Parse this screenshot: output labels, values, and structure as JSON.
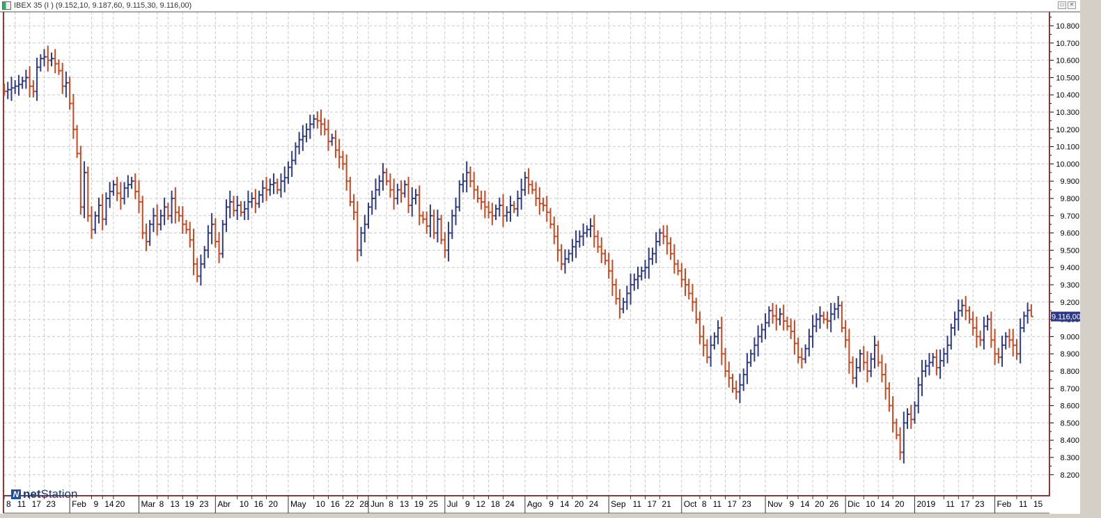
{
  "window": {
    "title": "IBEX 35 (I ) (9.152,10, 9.187,60, 9.115,30, 9.116,00)",
    "restore_icon": "restore-icon",
    "close_icon": "close-icon"
  },
  "logo": {
    "prefix": "net",
    "suffix": "Station"
  },
  "colors": {
    "up": "#2e3a86",
    "down": "#c8471e",
    "grid": "#c8c8c8",
    "frame": "#8b3a3a",
    "last_bg": "#2e3a86"
  },
  "chart_data": {
    "type": "ohlc",
    "title": "IBEX 35 (I )",
    "ylim": [
      8100,
      10900
    ],
    "yticks": [
      8200,
      8300,
      8400,
      8500,
      8600,
      8700,
      8800,
      8900,
      9000,
      9100,
      9200,
      9300,
      9400,
      9500,
      9600,
      9700,
      9800,
      9900,
      10000,
      10100,
      10200,
      10300,
      10400,
      10500,
      10600,
      10700,
      10800
    ],
    "ytick_labels": [
      "8.200",
      "8.300",
      "8.400",
      "8.500",
      "8.600",
      "8.700",
      "8.800",
      "8.900",
      "9.000",
      "9.100",
      "9.200",
      "9.300",
      "9.400",
      "9.500",
      "9.600",
      "9.700",
      "9.800",
      "9.900",
      "10.000",
      "10.100",
      "10.200",
      "10.300",
      "10.400",
      "10.500",
      "10.600",
      "10.700",
      "10.800"
    ],
    "last_value_label": "9.116,00",
    "last": {
      "open": 9152.1,
      "high": 9187.6,
      "low": 9115.3,
      "close": 9116.0
    },
    "closes": [
      10420,
      10430,
      10440,
      10450,
      10460,
      10480,
      10500,
      10450,
      10420,
      10560,
      10610,
      10620,
      10600,
      10610,
      10580,
      10540,
      10450,
      10470,
      10350,
      10200,
      10060,
      9750,
      9950,
      9700,
      9620,
      9700,
      9760,
      9680,
      9800,
      9840,
      9880,
      9830,
      9800,
      9860,
      9880,
      9900,
      9840,
      9780,
      9600,
      9550,
      9650,
      9700,
      9650,
      9700,
      9750,
      9700,
      9800,
      9720,
      9700,
      9650,
      9620,
      9560,
      9420,
      9350,
      9420,
      9500,
      9600,
      9650,
      9550,
      9480,
      9650,
      9750,
      9780,
      9730,
      9760,
      9720,
      9740,
      9780,
      9800,
      9770,
      9820,
      9860,
      9850,
      9880,
      9890,
      9850,
      9900,
      9920,
      9980,
      10020,
      10100,
      10140,
      10160,
      10200,
      10230,
      10260,
      10250,
      10230,
      10200,
      10130,
      10150,
      10080,
      10040,
      10000,
      9900,
      9780,
      9720,
      9500,
      9600,
      9650,
      9750,
      9800,
      9850,
      9900,
      9950,
      9900,
      9850,
      9800,
      9850,
      9830,
      9880,
      9760,
      9800,
      9820,
      9700,
      9680,
      9640,
      9700,
      9600,
      9680,
      9560,
      9500,
      9600,
      9700,
      9750,
      9880,
      9900,
      9950,
      9900,
      9850,
      9800,
      9780,
      9750,
      9720,
      9700,
      9740,
      9760,
      9700,
      9720,
      9760,
      9740,
      9800,
      9850,
      9920,
      9880,
      9850,
      9800,
      9770,
      9760,
      9720,
      9650,
      9580,
      9500,
      9420,
      9450,
      9480,
      9520,
      9550,
      9580,
      9600,
      9620,
      9640,
      9580,
      9520,
      9480,
      9440,
      9380,
      9300,
      9220,
      9160,
      9200,
      9250,
      9300,
      9330,
      9350,
      9380,
      9400,
      9450,
      9480,
      9550,
      9600,
      9580,
      9540,
      9480,
      9420,
      9380,
      9330,
      9300,
      9250,
      9200,
      9100,
      9000,
      8950,
      8880,
      8950,
      9000,
      9050,
      8900,
      8800,
      8760,
      8700,
      8680,
      8720,
      8780,
      8850,
      8900,
      8950,
      9000,
      9040,
      9080,
      9150,
      9120,
      9100,
      9130,
      9090,
      9060,
      9030,
      8960,
      8880,
      8870,
      8930,
      9000,
      9060,
      9100,
      9120,
      9100,
      9090,
      9130,
      9160,
      9180,
      9050,
      8980,
      8850,
      8760,
      8820,
      8900,
      8850,
      8800,
      8870,
      8950,
      8850,
      8780,
      8700,
      8600,
      8500,
      8430,
      8330,
      8500,
      8550,
      8520,
      8600,
      8720,
      8800,
      8830,
      8850,
      8880,
      8820,
      8860,
      8900,
      8950,
      9050,
      9100,
      9150,
      9180,
      9150,
      9100,
      9050,
      9000,
      8980,
      9060,
      9100,
      8980,
      8900,
      8880,
      8950,
      9000,
      8980,
      8950,
      8900,
      9050,
      9120,
      9152,
      9116
    ],
    "xticks": [
      {
        "i": 0,
        "t": "8"
      },
      {
        "i": 3,
        "t": "11"
      },
      {
        "i": 7,
        "t": "17"
      },
      {
        "i": 11,
        "t": "23"
      },
      {
        "i": 18,
        "t": "Feb",
        "m": 1
      },
      {
        "i": 24,
        "t": "9"
      },
      {
        "i": 27,
        "t": "14"
      },
      {
        "i": 30,
        "t": "20"
      },
      {
        "i": 37,
        "t": "Mar",
        "m": 1
      },
      {
        "i": 42,
        "t": "8"
      },
      {
        "i": 45,
        "t": "13"
      },
      {
        "i": 49,
        "t": "19"
      },
      {
        "i": 53,
        "t": "23"
      },
      {
        "i": 58,
        "t": "Abr",
        "m": 1
      },
      {
        "i": 64,
        "t": "10"
      },
      {
        "i": 68,
        "t": "16"
      },
      {
        "i": 72,
        "t": "20"
      },
      {
        "i": 78,
        "t": "May",
        "m": 1
      },
      {
        "i": 85,
        "t": "10"
      },
      {
        "i": 89,
        "t": "16"
      },
      {
        "i": 93,
        "t": "22"
      },
      {
        "i": 97,
        "t": "28"
      },
      {
        "i": 100,
        "t": "Jun",
        "m": 1
      },
      {
        "i": 105,
        "t": "8"
      },
      {
        "i": 108,
        "t": "13"
      },
      {
        "i": 112,
        "t": "19"
      },
      {
        "i": 116,
        "t": "25"
      },
      {
        "i": 121,
        "t": "Jul",
        "m": 1
      },
      {
        "i": 126,
        "t": "9"
      },
      {
        "i": 129,
        "t": "12"
      },
      {
        "i": 133,
        "t": "18"
      },
      {
        "i": 137,
        "t": "24"
      },
      {
        "i": 143,
        "t": "Ago",
        "m": 1
      },
      {
        "i": 149,
        "t": "9"
      },
      {
        "i": 152,
        "t": "14"
      },
      {
        "i": 156,
        "t": "20"
      },
      {
        "i": 160,
        "t": "24"
      },
      {
        "i": 166,
        "t": "Sep",
        "m": 1
      },
      {
        "i": 172,
        "t": "11"
      },
      {
        "i": 176,
        "t": "17"
      },
      {
        "i": 180,
        "t": "21"
      },
      {
        "i": 186,
        "t": "Oct",
        "m": 1
      },
      {
        "i": 191,
        "t": "8"
      },
      {
        "i": 194,
        "t": "11"
      },
      {
        "i": 198,
        "t": "17"
      },
      {
        "i": 202,
        "t": "23"
      },
      {
        "i": 209,
        "t": "Nov",
        "m": 1
      },
      {
        "i": 215,
        "t": "9"
      },
      {
        "i": 218,
        "t": "14"
      },
      {
        "i": 222,
        "t": "20"
      },
      {
        "i": 226,
        "t": "26"
      },
      {
        "i": 231,
        "t": "Dic",
        "m": 1
      },
      {
        "i": 236,
        "t": "10"
      },
      {
        "i": 240,
        "t": "14"
      },
      {
        "i": 244,
        "t": "20"
      },
      {
        "i": 250,
        "t": "2019",
        "m": 1
      },
      {
        "i": 258,
        "t": "11"
      },
      {
        "i": 262,
        "t": "17"
      },
      {
        "i": 266,
        "t": "23"
      },
      {
        "i": 272,
        "t": "Feb",
        "m": 1
      },
      {
        "i": 278,
        "t": "11"
      },
      {
        "i": 282,
        "t": "15"
      }
    ]
  }
}
